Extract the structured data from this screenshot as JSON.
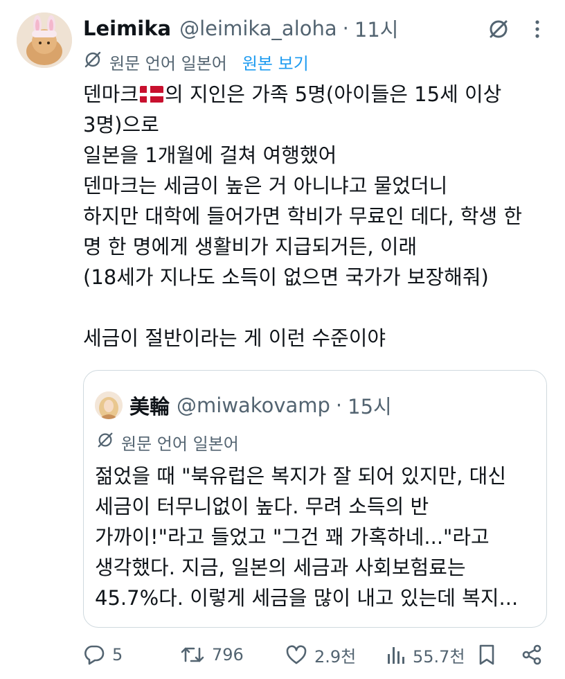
{
  "tweet": {
    "author_name": "Leimika",
    "handle": "@leimika_aloha",
    "separator": "·",
    "time": "11시",
    "translate_lang": "원문 언어 일본어",
    "show_original": "원본 보기",
    "lines": [
      {
        "before": "덴마크",
        "after": "의 지인은 가족 5명(아이들은 15세 이상"
      },
      "3명)으로",
      "일본을 1개월에 걸쳐 여행했어",
      "덴마크는 세금이 높은 거 아니냐고 물었더니",
      "하지만 대학에 들어가면 학비가 무료인 데다, 학생 한",
      "명 한 명에게 생활비가 지급되거든, 이래",
      "(18세가 지나도 소득이 없으면 국가가 보장해줘)",
      "",
      "세금이 절반이라는 게 이런 수준이야"
    ]
  },
  "quote": {
    "author_name": "美輪",
    "handle": "@miwakovamp",
    "separator": "·",
    "time": "15시",
    "translate_lang": "원문 언어 일본어",
    "lines": [
      "젊었을 때 \"북유럽은 복지가 잘 되어 있지만, 대신",
      "세금이 터무니없이 높다. 무려 소득의 반",
      "가까이!\"라고 들었고 \"그건 꽤 가혹하네...\"라고",
      "생각했다. 지금, 일본의 세금과 사회보험료는",
      "45.7%다. 이렇게 세금을 많이 내고 있는데 복지..."
    ]
  },
  "actions": {
    "replies": "5",
    "retweets": "796",
    "likes": "2.9천",
    "views": "55.7천"
  },
  "colors": {
    "text": "#0f1419",
    "secondary": "#536471",
    "link": "#1d9bf0",
    "border": "#cfd9de"
  }
}
